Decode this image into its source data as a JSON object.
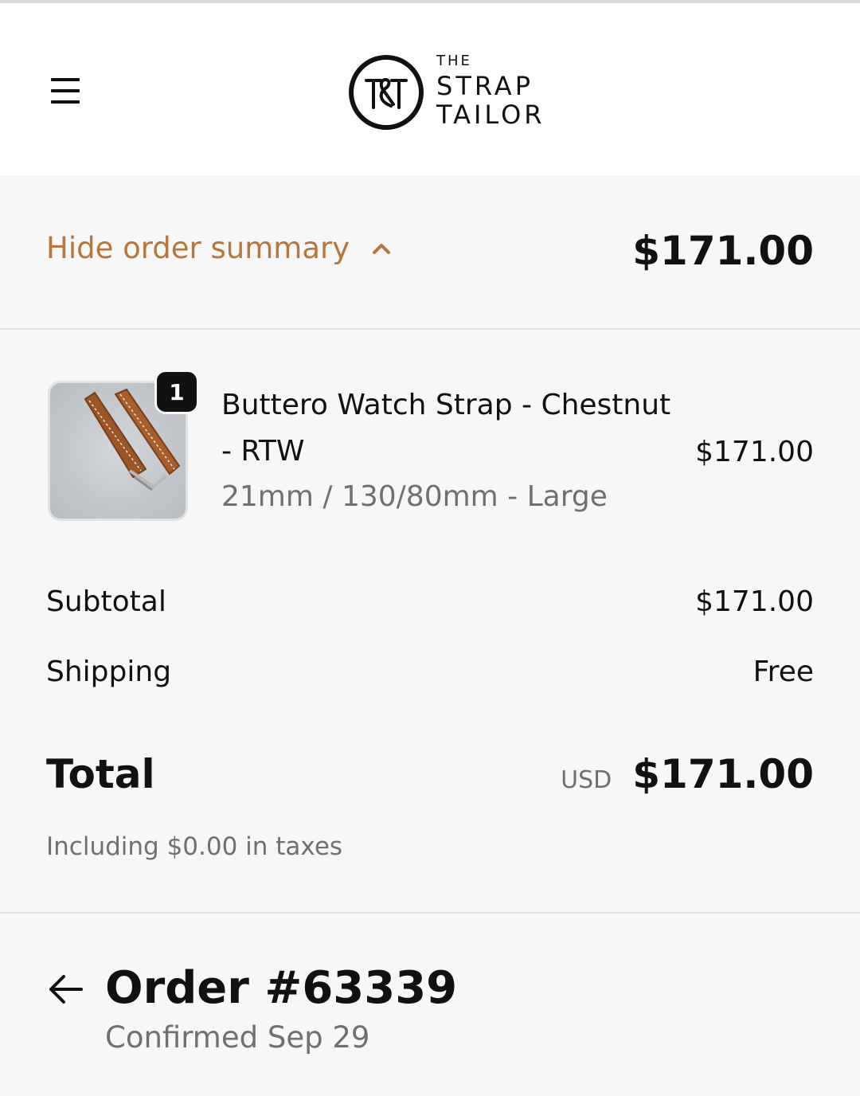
{
  "header": {
    "logo": {
      "monogram": "T&T",
      "line1": "THE",
      "line2": "STRAP",
      "line3": "TAILOR"
    },
    "menu_icon": "hamburger-menu-icon"
  },
  "summary": {
    "toggle_label": "Hide order summary",
    "toggle_icon": "chevron-up-icon",
    "total": "$171.00"
  },
  "items": [
    {
      "quantity": "1",
      "name": "Buttero Watch Strap - Chestnut - RTW",
      "variant": "21mm / 130/80mm - Large",
      "price": "$171.00",
      "image": "chestnut-leather-watch-strap"
    }
  ],
  "costs": {
    "subtotal_label": "Subtotal",
    "subtotal_value": "$171.00",
    "shipping_label": "Shipping",
    "shipping_value": "Free",
    "total_label": "Total",
    "currency": "USD",
    "total_value": "$171.00",
    "tax_note": "Including $0.00 in taxes"
  },
  "order": {
    "back_icon": "arrow-left-icon",
    "title": "Order #63339",
    "subtitle": "Confirmed Sep 29"
  },
  "colors": {
    "accent": "#b7773a",
    "background": "#f7f7f7",
    "header_background": "#ffffff",
    "text_primary": "#111111",
    "text_muted": "#707070",
    "divider": "#dedede"
  }
}
